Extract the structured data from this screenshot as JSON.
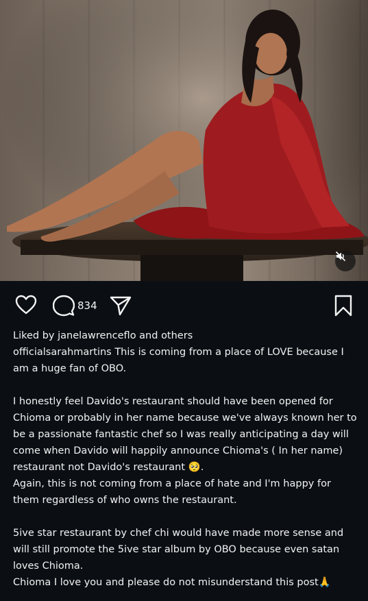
{
  "post": {
    "comment_count": "834",
    "liked_by": "Liked by janelawrenceflo and others",
    "caption_username": "officialsarahmartins",
    "caption_paragraphs": [
      "This is coming from a place of LOVE because I am a huge fan of OBO.",
      "",
      "I honestly feel Davido's restaurant should have been opened for Chioma or probably in her name because we've always known her to be a passionate fantastic chef so I was really anticipating a day will come when Davido will happily announce Chioma's ( In her name) restaurant not Davido's restaurant 🥺.",
      "Again, this is not coming from a place of hate and I'm happy for them regardless of who owns the restaurant.",
      "",
      "5ive star restaurant by chef chi would have made more sense and will still promote the 5ive star album by OBO because even satan loves Chioma.",
      "Chioma I love you and please do not misunderstand this post🙏"
    ]
  },
  "icons": {
    "like": "heart-icon",
    "comment": "comment-icon",
    "share": "send-icon",
    "save": "bookmark-icon",
    "mute": "speaker-muted-icon"
  },
  "colors": {
    "background": "#0b0f14",
    "text": "#f2f2f2",
    "dress": "#9e1c1f"
  }
}
